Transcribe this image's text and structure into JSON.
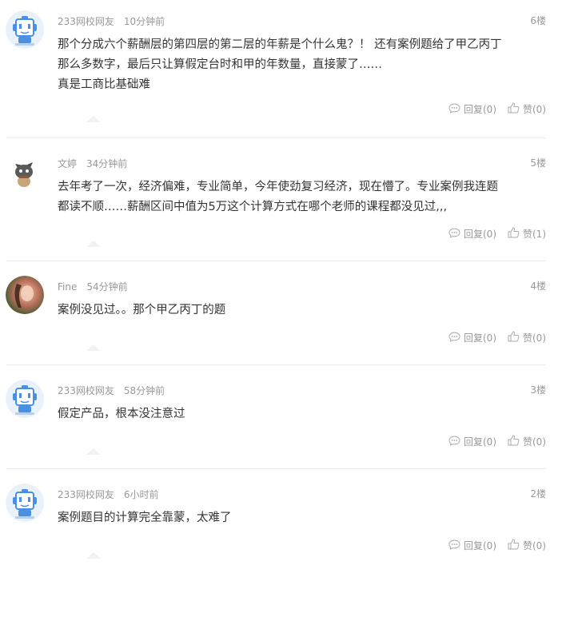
{
  "comments": [
    {
      "user": "233网校网友",
      "time": "10分钟前",
      "floor": "6楼",
      "avatar": "robot-avatar",
      "lines": [
        "那个分成六个薪酬层的第四层的第二层的年薪是个什么鬼？！ 还有案例题给了甲乙丙丁",
        "那么多数字，最后只让算假定台时和甲的年数量，直接蒙了……",
        "真是工商比基础难"
      ],
      "reply_label": "回复(0)",
      "like_label": "赞(0)"
    },
    {
      "user": "文婷",
      "time": "34分钟前",
      "floor": "5楼",
      "avatar": "cat-avatar",
      "lines": [
        "去年考了一次，经济偏难，专业简单，今年使劲复习经济，现在懵了。专业案例我连题",
        "都读不顺……薪酬区间中值为5万这个计算方式在哪个老师的课程都没见过,,,"
      ],
      "reply_label": "回复(0)",
      "like_label": "赞(1)"
    },
    {
      "user": "Fine",
      "time": "54分钟前",
      "floor": "4楼",
      "avatar": "photo-avatar",
      "lines": [
        "案例没见过。。那个甲乙丙丁的题"
      ],
      "reply_label": "回复(0)",
      "like_label": "赞(0)"
    },
    {
      "user": "233网校网友",
      "time": "58分钟前",
      "floor": "3楼",
      "avatar": "robot-avatar",
      "lines": [
        "假定产品，根本没注意过"
      ],
      "reply_label": "回复(0)",
      "like_label": "赞(0)"
    },
    {
      "user": "233网校网友",
      "time": "6小时前",
      "floor": "2楼",
      "avatar": "robot-avatar",
      "lines": [
        "案例题目的计算完全靠蒙，太难了"
      ],
      "reply_label": "回复(0)",
      "like_label": "赞(0)"
    }
  ],
  "colors": {
    "meta": "#999999",
    "text": "#333333",
    "divider": "#ececec",
    "robot": "#4a90e2"
  }
}
